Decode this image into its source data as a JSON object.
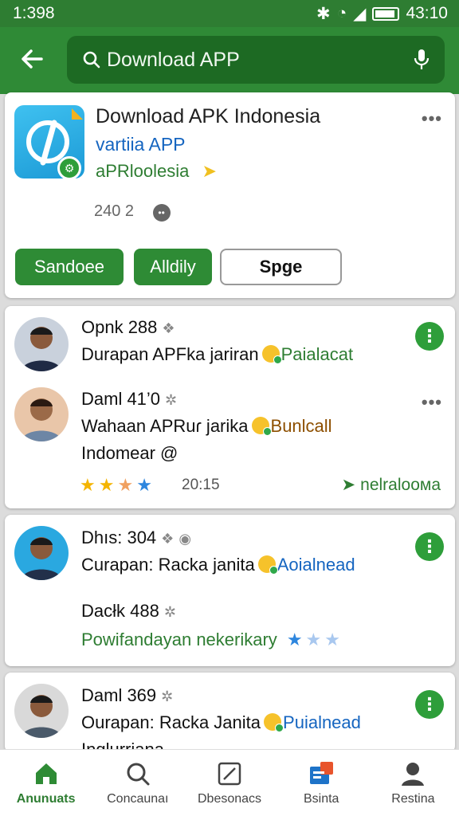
{
  "status_bar": {
    "time": "1:398",
    "clock": "43:10"
  },
  "search": {
    "value": "Download APP"
  },
  "app_card": {
    "title": "Download APK Indonesia",
    "developer": "vartiia APP",
    "subtitle": "aPRloolesia",
    "count": "240 2",
    "chips": [
      "Sandoee",
      "Alldily",
      "Spge"
    ]
  },
  "reviews": [
    {
      "name": "Opnk 288",
      "text": "Durapan APFka jariran",
      "accent": "Paialacat"
    },
    {
      "name": "Daml 41’0",
      "text": "Wahaan APRuɾ jarika",
      "accent": "Bunlcall",
      "text2": "Indomear @",
      "rating_stars": "★★★★",
      "rating_value": "20:15",
      "link": "nelraloома"
    },
    {
      "name": "Dhıs: 304",
      "text": "Curapan: Racka janita",
      "accent": "Aoialnead"
    },
    {
      "name": "Dacłk 488",
      "green_text": "Powifandayan nekerikary",
      "stars": "★★★"
    },
    {
      "name": "Daml 369",
      "text": "Ourapan: Racka Janita",
      "accent": "Puialnead",
      "text2": "Inglurriana"
    }
  ],
  "bottom_nav": [
    "Anunuats",
    "Concaunaı",
    "Dbesonacs",
    "Bsinta",
    "Restina"
  ],
  "colors": {
    "primary": "#2f8a36",
    "status_bar": "#2e7d32",
    "link_blue": "#1565c0",
    "accent_green": "#2e7d32"
  }
}
